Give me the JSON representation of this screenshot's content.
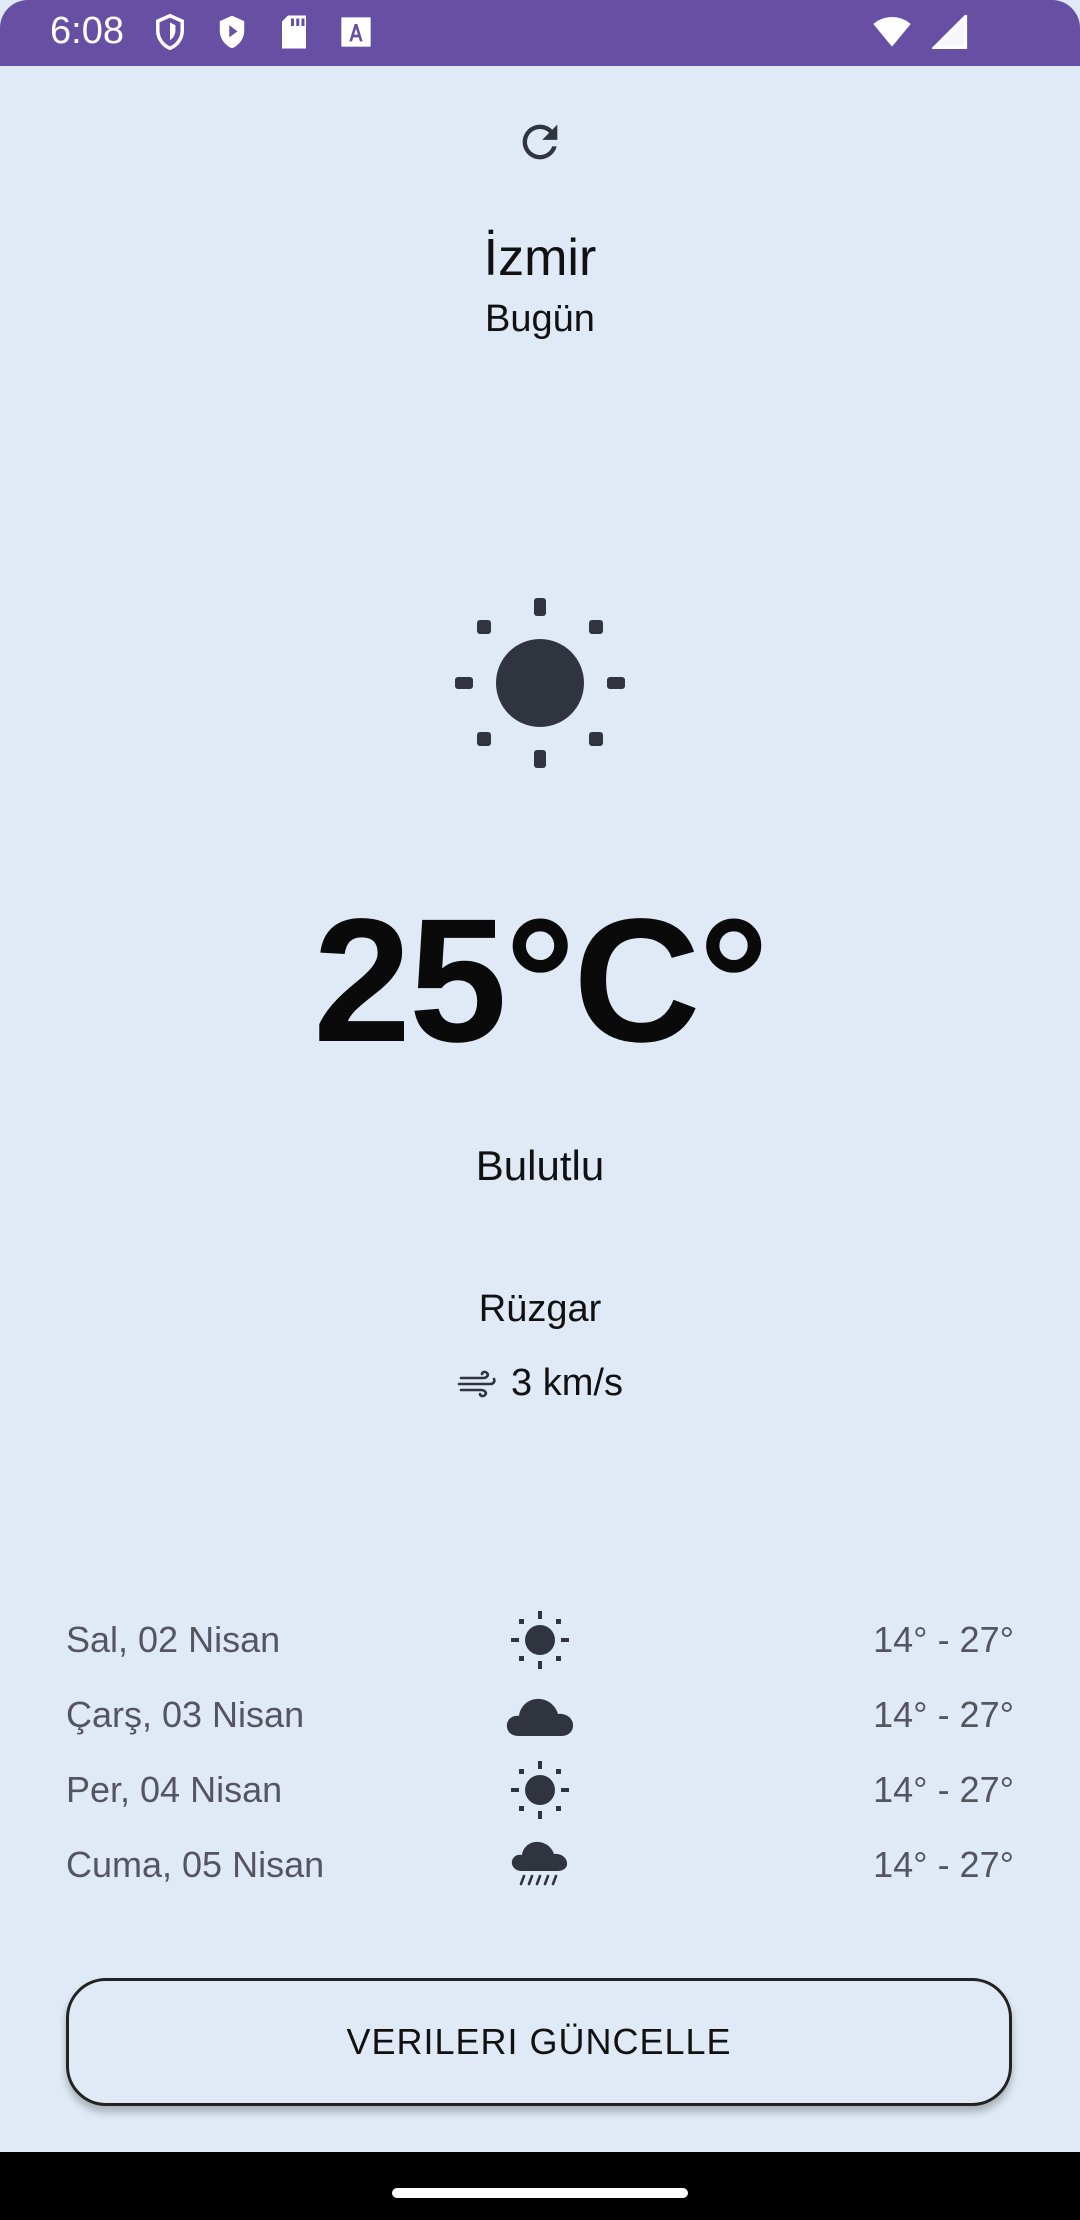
{
  "status_bar": {
    "time": "6:08",
    "left_icons": [
      "shield-outline-icon",
      "shield-play-icon",
      "sd-card-icon",
      "text-a-icon"
    ],
    "right_icons": [
      "wifi-icon",
      "cellular-signal-icon"
    ],
    "background_color": "#6750a4"
  },
  "header": {
    "refresh_icon": "refresh-icon",
    "city": "İzmir",
    "day": "Bugün"
  },
  "current": {
    "icon": "sun-icon",
    "temperature": "25°C°",
    "condition": "Bulutlu",
    "wind_label": "Rüzgar",
    "wind_icon": "wind-icon",
    "wind_speed": "3 km/s"
  },
  "forecast": [
    {
      "date": "Sal, 02 Nisan",
      "icon": "sun-icon",
      "range": "14° - 27°"
    },
    {
      "date": "Çarş, 03 Nisan",
      "icon": "cloud-icon",
      "range": "14° - 27°"
    },
    {
      "date": "Per, 04 Nisan",
      "icon": "sun-icon",
      "range": "14° - 27°"
    },
    {
      "date": "Cuma, 05 Nisan",
      "icon": "rain-cloud-icon",
      "range": "14° - 27°"
    }
  ],
  "actions": {
    "update_label": "VERILERI GÜNCELLE"
  },
  "colors": {
    "background": "#dfeaf6",
    "icon": "#30343f",
    "text_secondary": "#555560"
  }
}
